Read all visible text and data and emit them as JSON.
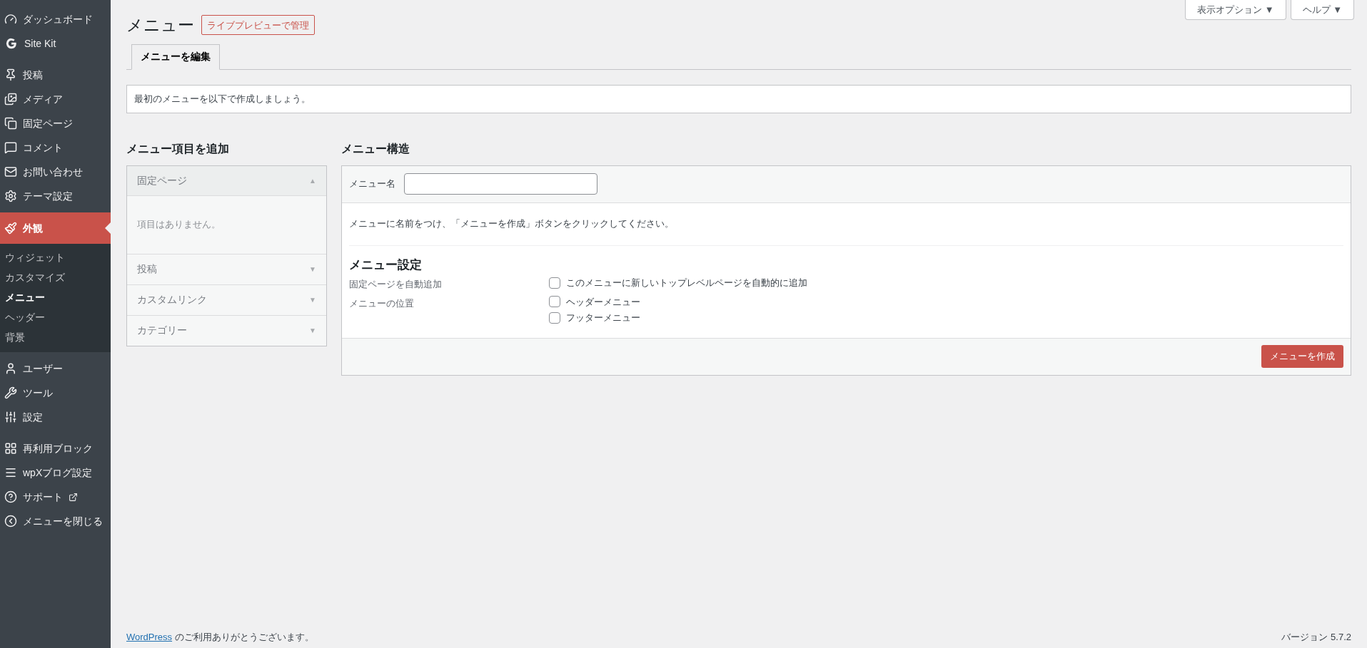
{
  "sidebar": {
    "groups": [
      [
        {
          "label": "ダッシュボード",
          "selected": false
        },
        {
          "label": "Site Kit",
          "selected": false
        }
      ],
      [
        {
          "label": "投稿",
          "selected": false
        },
        {
          "label": "メディア",
          "selected": false
        },
        {
          "label": "固定ページ",
          "selected": false
        },
        {
          "label": "コメント",
          "selected": false
        },
        {
          "label": "お問い合わせ",
          "selected": false
        },
        {
          "label": "テーマ設定",
          "selected": false
        },
        {
          "label": "外観",
          "selected": true,
          "children": [
            {
              "label": "ウィジェット",
              "selected": false
            },
            {
              "label": "カスタマイズ",
              "selected": false
            },
            {
              "label": "メニュー",
              "selected": true
            },
            {
              "label": "ヘッダー",
              "selected": false
            },
            {
              "label": "背景",
              "selected": false
            }
          ]
        },
        {
          "label": "ユーザー",
          "selected": false
        },
        {
          "label": "ツール",
          "selected": false
        },
        {
          "label": "設定",
          "selected": false
        }
      ],
      [
        {
          "label": "再利用ブロック",
          "selected": false
        },
        {
          "label": "wpXブログ設定",
          "selected": false
        },
        {
          "label": "サポート",
          "selected": false,
          "external": true
        },
        {
          "label": "メニューを閉じる",
          "selected": false
        }
      ]
    ]
  },
  "screen_buttons": [
    "表示オプション ▼",
    "ヘルプ ▼"
  ],
  "page_title": "メニュー",
  "title_action": "ライブプレビューで管理",
  "tabs": [
    {
      "label": "メニューを編集",
      "selected": true
    }
  ],
  "notice": "最初のメニューを以下で作成しましょう。",
  "add_items": {
    "heading": "メニュー項目を追加",
    "sections": [
      {
        "title": "固定ページ",
        "expanded": true,
        "toggle": "▲",
        "empty_text": "項目はありません。"
      },
      {
        "title": "投稿",
        "expanded": false,
        "toggle": "▼"
      },
      {
        "title": "カスタムリンク",
        "expanded": false,
        "toggle": "▼"
      },
      {
        "title": "カテゴリー",
        "expanded": false,
        "toggle": "▼"
      }
    ]
  },
  "structure": {
    "heading": "メニュー構造",
    "name_label": "メニュー名",
    "instructions": "メニューに名前をつけ、「メニューを作成」ボタンをクリックしてください。",
    "settings_heading": "メニュー設定",
    "settings": [
      {
        "label": "固定ページを自動追加",
        "options": [
          {
            "label": "このメニューに新しいトップレベルページを自動的に追加",
            "checked": false
          }
        ]
      },
      {
        "label": "メニューの位置",
        "options": [
          {
            "label": "ヘッダーメニュー",
            "checked": false
          },
          {
            "label": "フッターメニュー",
            "checked": false
          }
        ]
      }
    ],
    "create_button": "メニューを作成"
  },
  "footer": {
    "link": "WordPress",
    "thanks": "のご利用ありがとうございます。",
    "version": "バージョン 5.7.2"
  }
}
